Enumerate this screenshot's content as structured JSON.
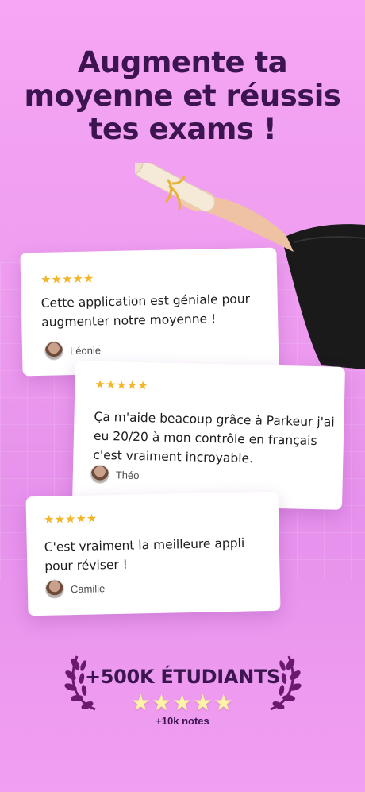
{
  "headline": {
    "line1": "Augmente ta",
    "line2": "moyenne et réussis",
    "line3": "tes exams !"
  },
  "reviews": [
    {
      "stars": "★★★★★",
      "text": "Cette application est géniale pour augmenter notre moyenne !",
      "author": "Léonie"
    },
    {
      "stars": "★★★★★",
      "text": "Ça m'aide beacoup grâce à Parkeur j'ai eu 20/20 à mon contrôle en français c'est vraiment incroyable.",
      "author": "Théo"
    },
    {
      "stars": "★★★★★",
      "text": "C'est vraiment la meilleure appli pour réviser !",
      "author": "Camille"
    }
  ],
  "badge": {
    "title": "+500K ÉTUDIANTS",
    "stars": "★★★★★",
    "subtitle": "+10k notes"
  },
  "colors": {
    "background": "#ee9df0",
    "headline": "#3b1450",
    "star": "#f3b52a",
    "laurel": "#6a1a6e"
  }
}
